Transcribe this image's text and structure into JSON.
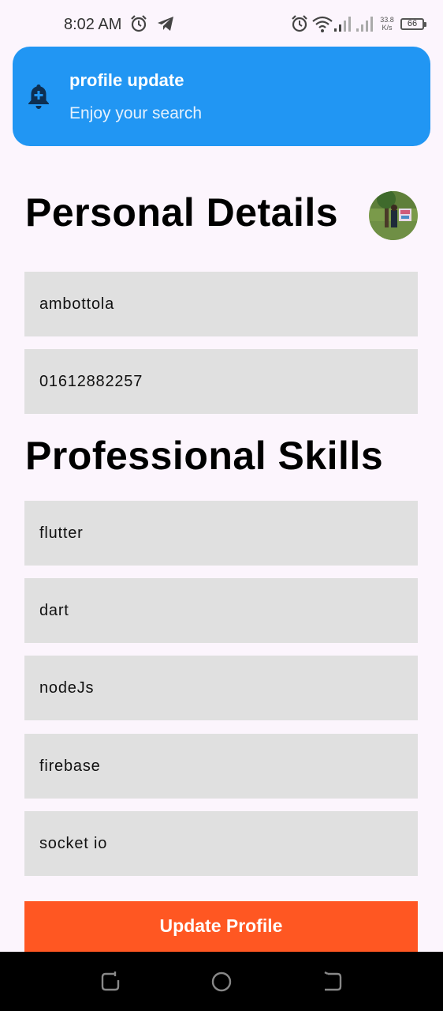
{
  "status_bar": {
    "time": "8:02 AM",
    "net_speed_value": "33.8",
    "net_speed_unit": "K/s",
    "battery": "66",
    "icons": [
      "alarm-icon",
      "telegram-icon",
      "alarm-icon",
      "wifi-icon",
      "signal-icon",
      "signal-icon",
      "battery-icon"
    ]
  },
  "notification": {
    "icon": "bell-plus-icon",
    "title": "profile update",
    "subtitle": "Enjoy your search"
  },
  "personal": {
    "heading": "Personal Details",
    "name": "ambottola",
    "phone": "01612882257"
  },
  "skills": {
    "heading": "Professional Skills",
    "items": [
      "flutter",
      "dart",
      "nodeJs",
      "firebase",
      "socket io"
    ]
  },
  "update_button_label": "Update Profile",
  "colors": {
    "banner": "#2196f3",
    "button": "#ff5722",
    "field": "#e0e0e0",
    "background": "#fcf5fd"
  },
  "nav_bar": {
    "icons": [
      "recent-apps-icon",
      "home-icon",
      "back-icon"
    ]
  }
}
